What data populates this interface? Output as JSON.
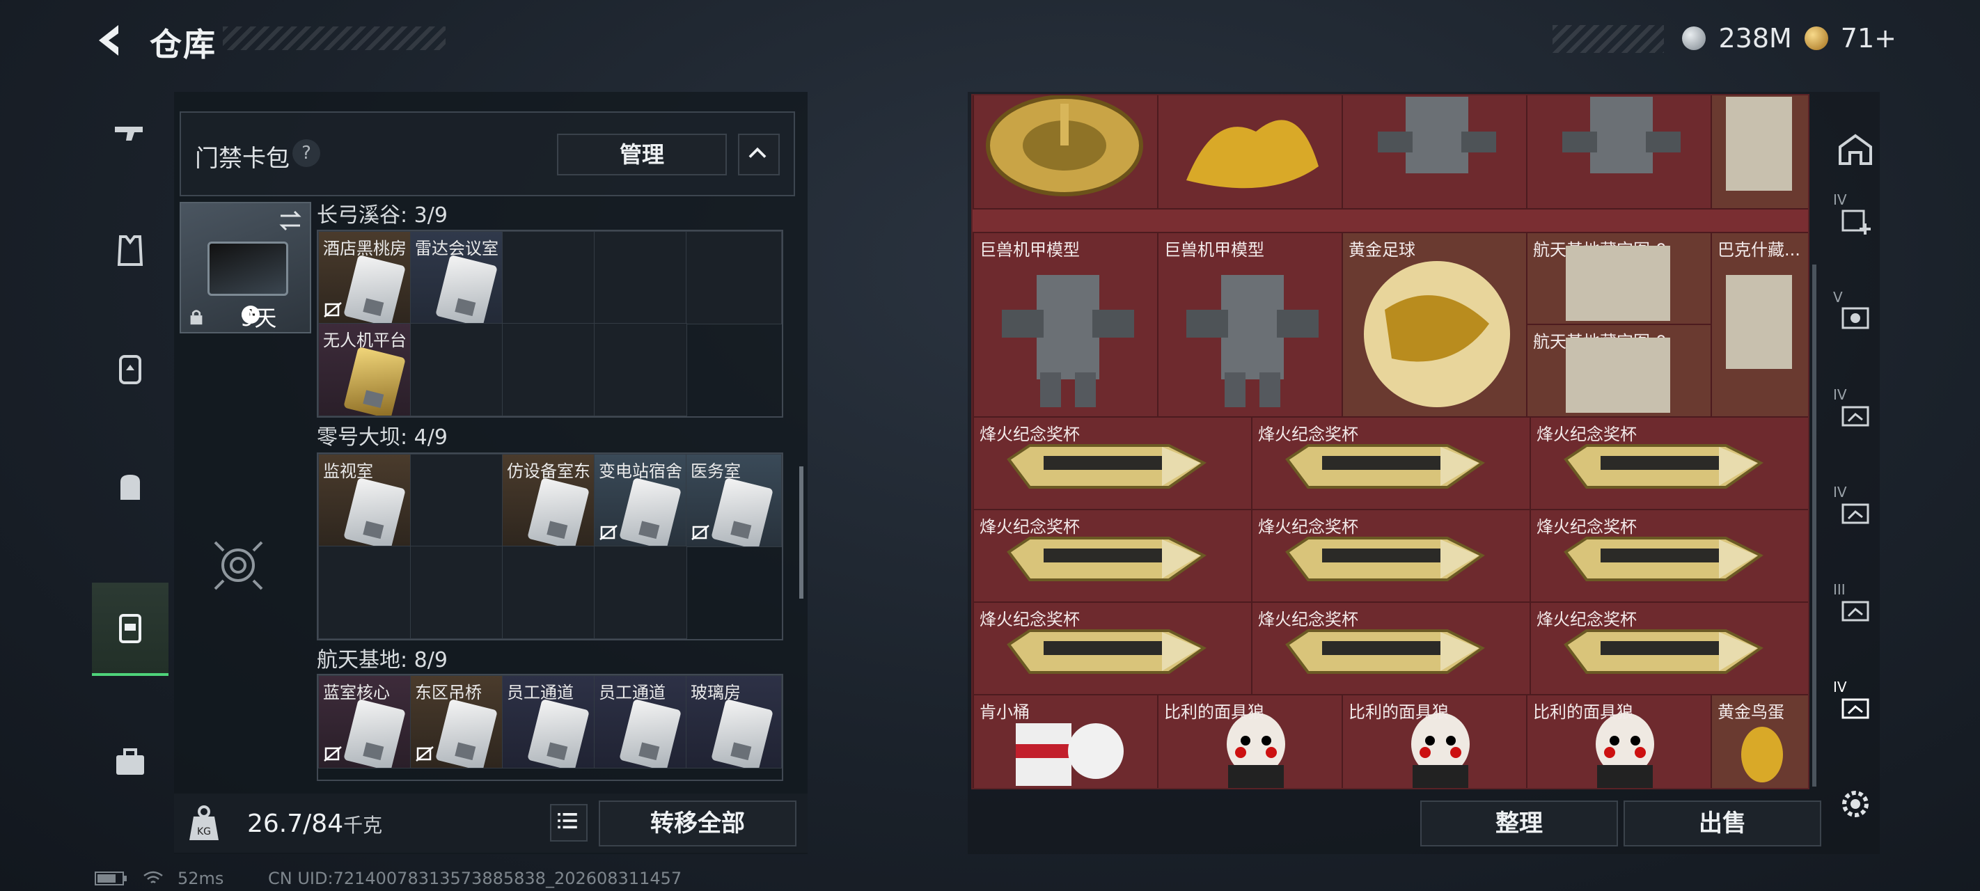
{
  "header": {
    "title": "仓库",
    "currency_a": "238M",
    "currency_b": "71+"
  },
  "keycase": {
    "title": "门禁卡包",
    "help": "?",
    "manage_label": "管理",
    "timer": "9天"
  },
  "sections": [
    {
      "label": "长弓溪谷: 3/9",
      "cells": [
        {
          "name": "酒店黑桃房",
          "bg": "brown",
          "card": "silver",
          "nobind": true
        },
        {
          "name": "雷达会议室",
          "bg": "blue",
          "card": "silver",
          "nobind": false
        },
        {
          "name": "无人机平台",
          "bg": "purple",
          "card": "gold",
          "nobind": false
        }
      ]
    },
    {
      "label": "零号大坝: 4/9",
      "cells": [
        {
          "name": "监视室",
          "bg": "brown",
          "card": "silver",
          "nobind": false
        },
        {
          "name": "仿设备室东",
          "bg": "brown",
          "card": "silver",
          "nobind": false
        },
        {
          "name": "变电站宿舍",
          "bg": "steel",
          "card": "silver",
          "nobind": true
        },
        {
          "name": "医务室",
          "bg": "steel",
          "card": "silver",
          "nobind": true
        }
      ]
    },
    {
      "label": "航天基地: 8/9",
      "cells": [
        {
          "name": "蓝室核心",
          "bg": "purple",
          "card": "silver",
          "nobind": true
        },
        {
          "name": "东区吊桥",
          "bg": "brown",
          "card": "silver",
          "nobind": true
        },
        {
          "name": "员工通道",
          "bg": "navy",
          "card": "silver",
          "nobind": false
        },
        {
          "name": "员工通道",
          "bg": "navy",
          "card": "silver",
          "nobind": false
        },
        {
          "name": "玻璃房",
          "bg": "navy",
          "card": "silver",
          "nobind": false
        }
      ]
    }
  ],
  "weight": {
    "value": "26.7/84",
    "unit": "千克"
  },
  "buttons": {
    "transfer_all": "转移全部",
    "sort": "整理",
    "sell": "出售"
  },
  "stash": {
    "row1_names": [
      "",
      "",
      "",
      "",
      ""
    ],
    "row2": [
      "巨兽机甲模型",
      "巨兽机甲模型",
      "黄金足球",
      "航天基地藏宝图-9",
      "巴克什藏..."
    ],
    "row2_extra": "航天基地藏宝图-9",
    "trophy_name": "烽火纪念奖杯",
    "last_row": [
      "肯小桶",
      "比利的面具狼",
      "比利的面具狼",
      "比利的面具狼",
      "黄金鸟蛋"
    ]
  },
  "filters": [
    {
      "label": "",
      "icon": "home-icon"
    },
    {
      "label": "IV",
      "icon": "add-icon"
    },
    {
      "label": "V",
      "icon": "gear-card-icon"
    },
    {
      "label": "IV",
      "icon": "card-icon"
    },
    {
      "label": "IV",
      "icon": "card-icon"
    },
    {
      "label": "III",
      "icon": "card-icon"
    },
    {
      "label": "IV",
      "icon": "card-select-icon"
    }
  ],
  "status": {
    "ping": "52ms",
    "uid": "CN UID:7214007831357388583​8_202608311457"
  },
  "colors": {
    "accent": "#4ed37a",
    "stash_bg": "#7a2e32"
  }
}
